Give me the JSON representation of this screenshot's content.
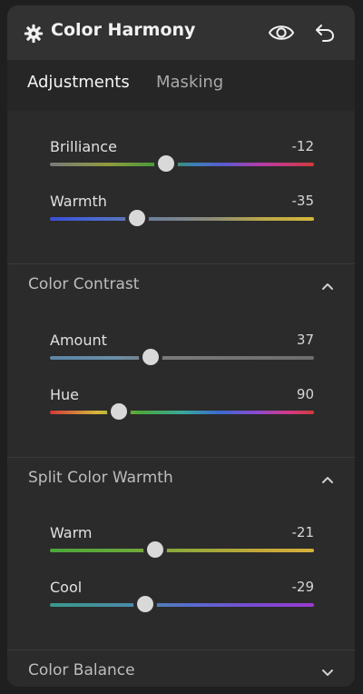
{
  "header": {
    "title": "Color Harmony",
    "icons": [
      "gear-icon",
      "eye-icon",
      "undo-icon"
    ]
  },
  "tabs": [
    {
      "label": "Adjustments",
      "active": true
    },
    {
      "label": "Masking",
      "active": false
    }
  ],
  "sliders": {
    "brilliance": {
      "label": "Brilliance",
      "value": "-12",
      "thumb_fraction": 0.44
    },
    "warmth": {
      "label": "Warmth",
      "value": "-35",
      "thumb_fraction": 0.33
    },
    "amount": {
      "label": "Amount",
      "value": "37",
      "thumb_fraction": 0.38
    },
    "hue": {
      "label": "Hue",
      "value": "90",
      "thumb_fraction": 0.26
    },
    "warm": {
      "label": "Warm",
      "value": "-21",
      "thumb_fraction": 0.4
    },
    "cool": {
      "label": "Cool",
      "value": "-29",
      "thumb_fraction": 0.36
    }
  },
  "sections": {
    "color_contrast": {
      "label": "Color Contrast",
      "expanded": true
    },
    "split_color_warmth": {
      "label": "Split Color Warmth",
      "expanded": true
    },
    "color_balance": {
      "label": "Color Balance",
      "expanded": false
    }
  },
  "colors": {
    "background": "#1f1f1f",
    "panel": "#2b2b2b",
    "header": "#323232",
    "thumb": "#d9d9d9"
  }
}
